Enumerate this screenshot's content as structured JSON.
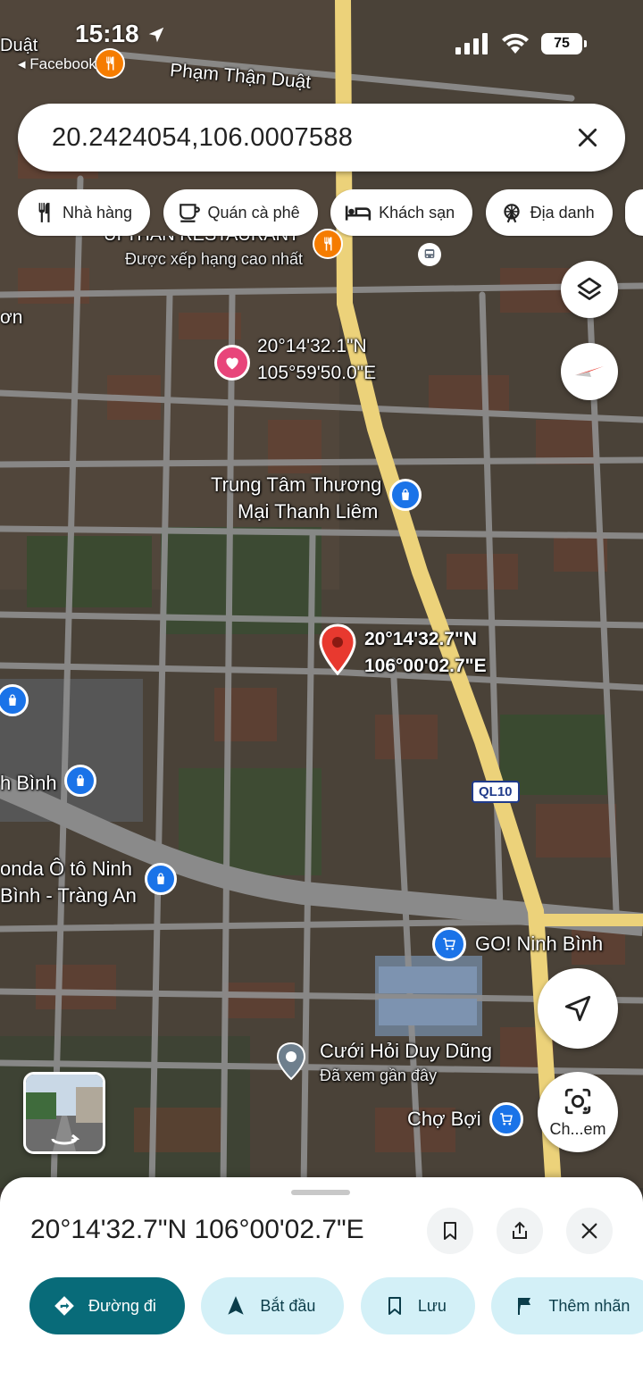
{
  "status_bar": {
    "time": "15:18",
    "back_label": "◂ Facebook",
    "battery": "75",
    "icons": [
      "location-arrow-icon",
      "cellular-signal-icon",
      "wifi-icon",
      "battery-icon"
    ]
  },
  "search": {
    "value": "20.2424054,106.0007588",
    "clear_icon": "close-icon"
  },
  "chips": [
    {
      "label": "Nhà hàng",
      "icon": "fork-knife-icon"
    },
    {
      "label": "Quán cà phê",
      "icon": "coffee-cup-icon"
    },
    {
      "label": "Khách sạn",
      "icon": "bed-icon"
    },
    {
      "label": "Địa danh",
      "icon": "ferris-wheel-icon"
    }
  ],
  "map": {
    "street_labels": {
      "top_left": "Duật",
      "top": "Phạm Thận Duật",
      "left_fragment": "ơn",
      "road_shield": "QL10"
    },
    "restaurant": {
      "name": "ỦI THÂN RESTAURANT",
      "note": "Được xếp hạng cao nhất"
    },
    "saved_pin": {
      "lat": "20°14'32.1\"N",
      "lng": "105°59'50.0\"E"
    },
    "dropped_pin": {
      "lat": "20°14'32.7\"N",
      "lng": "106°00'02.7\"E"
    },
    "pois": {
      "trung_tam_line1": "Trung Tâm Thương",
      "trung_tam_line2": "Mại Thanh Liêm",
      "ninh_binh_left": "h Bình",
      "honda_line1": "onda Ô tô Ninh",
      "honda_line2": "Bình - Tràng An",
      "go_ninh_binh": "GO! Ninh Bình",
      "cuoi_hoi": "Cưới Hỏi Duy Dũng",
      "cuoi_hoi_note": "Đã xem gần đây",
      "cho_boi": "Chợ Bợi"
    }
  },
  "controls": {
    "lens_label": "Ch...em"
  },
  "sheet": {
    "title": "20°14'32.7\"N 106°00'02.7\"E",
    "actions": [
      {
        "label": "Đường đi",
        "icon": "directions-icon"
      },
      {
        "label": "Bắt đầu",
        "icon": "navigation-arrow-icon"
      },
      {
        "label": "Lưu",
        "icon": "bookmark-icon"
      },
      {
        "label": "Thêm nhãn",
        "icon": "flag-icon"
      }
    ]
  },
  "colors": {
    "primary_action": "#086b79",
    "secondary_action": "#d3f0f7",
    "pin_red": "#e8392f",
    "poi_blue": "#1a73e8",
    "highway": "#ecd27a"
  }
}
